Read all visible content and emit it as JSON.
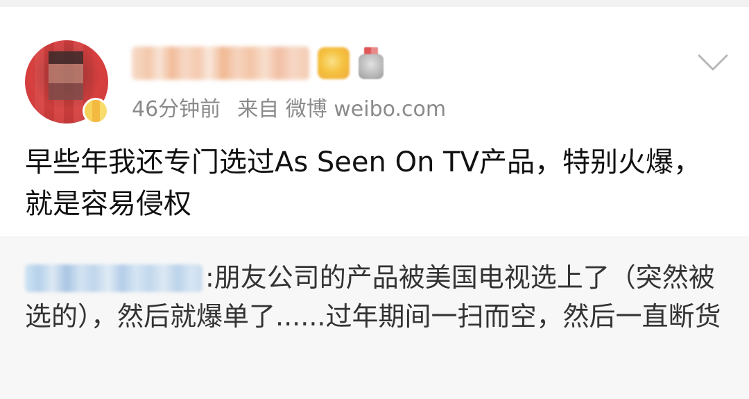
{
  "post": {
    "time_ago": "46分钟前",
    "source": "来自 微博 weibo.com",
    "text": "早些年我还专门选过As Seen On TV产品，特别火爆，就是容易侵权"
  },
  "quoted_comment": {
    "text": ":朋友公司的产品被美国电视选上了（突然被选的），然后就爆单了......过年期间一扫而空，然后一直断货"
  },
  "icons": {
    "more": "chevron-down-icon"
  },
  "colors": {
    "meta_gray": "#8a8a8a",
    "quoted_bg": "#f7f7f7",
    "page_bg": "#ffffff"
  }
}
